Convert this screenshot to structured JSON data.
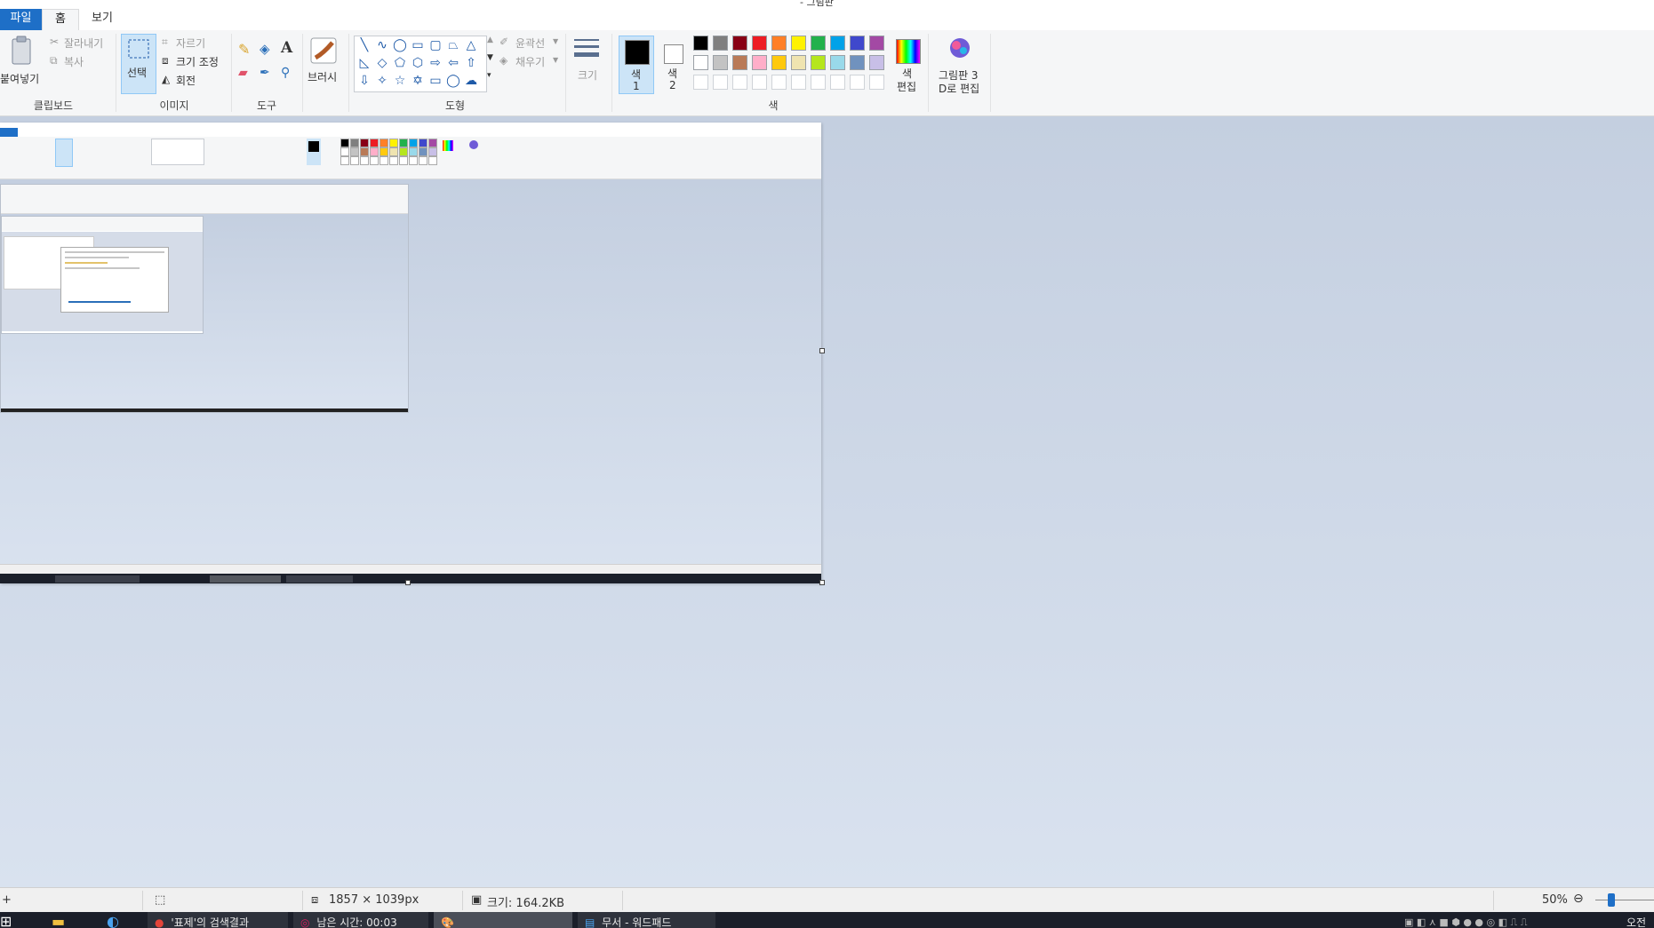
{
  "window": {
    "title": "- 그림판"
  },
  "tabs": {
    "file": "파일",
    "home": "홈",
    "view": "보기"
  },
  "ribbon": {
    "clipboard": {
      "paste": "붙여넣기",
      "cut": "잘라내기",
      "copy": "복사",
      "group": "클립보드"
    },
    "image": {
      "select": "선택",
      "crop": "자르기",
      "resize": "크기 조정",
      "rotate": "회전",
      "group": "이미지"
    },
    "tools": {
      "group": "도구"
    },
    "brush": {
      "label": "브러시"
    },
    "shapes": {
      "outline": "윤곽선",
      "fill": "채우기",
      "group": "도형"
    },
    "size": {
      "label": "크기"
    },
    "colors": {
      "color1": "색",
      "color1_num": "1",
      "color2": "색",
      "color2_num": "2",
      "edit_colors_line1": "색",
      "edit_colors_line2": "편집",
      "paint3d_line1": "그림판 3",
      "paint3d_line2": "D로 편집",
      "group": "색",
      "palette_row1": [
        "#000000",
        "#7f7f7f",
        "#880015",
        "#ed1c24",
        "#ff7f27",
        "#fff200",
        "#22b14c",
        "#00a2e8",
        "#3f48cc",
        "#a349a4"
      ],
      "palette_row2": [
        "#ffffff",
        "#c3c3c3",
        "#b97a57",
        "#ffaec9",
        "#ffc90e",
        "#efe4b0",
        "#b5e61d",
        "#99d9ea",
        "#7092be",
        "#c8bfe7"
      ]
    }
  },
  "statusbar": {
    "dimensions": "1857 × 1039px",
    "size": "크기: 164.2KB",
    "zoom": "50%"
  },
  "taskbar": {
    "item1": "'표제'의 검색결과",
    "item2": "남은 시간: 00:03",
    "item4": "무서 - 워드패드",
    "clock": "오전"
  }
}
